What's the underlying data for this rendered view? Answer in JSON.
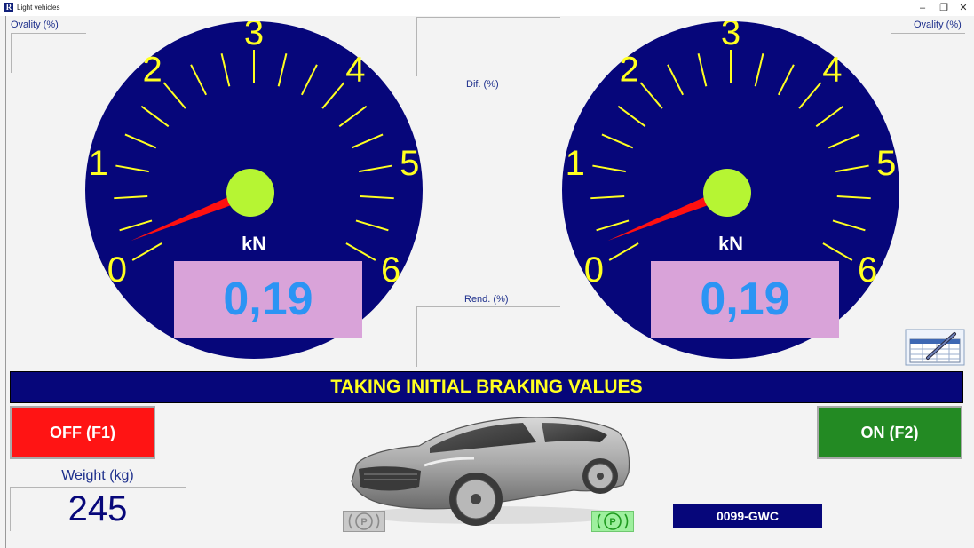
{
  "window": {
    "title": "Light vehicles",
    "logo_letter": "R",
    "minimize_glyph": "–",
    "restore_glyph": "❐",
    "close_glyph": "✕"
  },
  "left_panel": {
    "ovality_label": "Ovality (%)"
  },
  "right_panel": {
    "ovality_label": "Ovality (%)"
  },
  "center": {
    "dif_label": "Dif. (%)",
    "rend_label": "Rend. (%)"
  },
  "gauges": {
    "scale_min": 0,
    "scale_max": 6,
    "scale_labels": [
      "0",
      "1",
      "2",
      "3",
      "4",
      "5",
      "6"
    ],
    "unit": "kN",
    "left": {
      "value": 0.19,
      "display": "0,19"
    },
    "right": {
      "value": 0.19,
      "display": "0,19"
    },
    "dial_color": "#06067a",
    "number_color": "#ffff20",
    "needle_color": "#ff1010",
    "hub_color": "#b6f533"
  },
  "status": {
    "banner_text": "TAKING INITIAL BRAKING VALUES"
  },
  "controls": {
    "off_button": "OFF (F1)",
    "on_button": "ON (F2)",
    "off_color": "#ff1414",
    "on_color": "#238a23"
  },
  "weight": {
    "label": "Weight (kg)",
    "value": "245"
  },
  "vehicle": {
    "plate": "0099-GWC"
  },
  "parking_brakes": {
    "left": {
      "symbol": "(P)",
      "state": "inactive"
    },
    "right": {
      "symbol": "(P)",
      "state": "active"
    }
  },
  "icons": {
    "report": "report-table-pen-icon",
    "car": "suv-car-icon"
  }
}
